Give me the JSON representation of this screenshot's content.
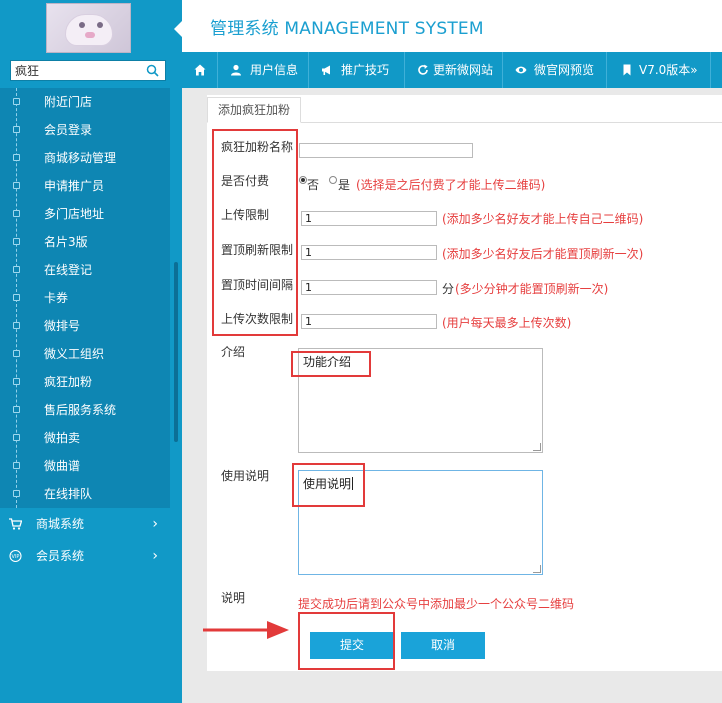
{
  "header": {
    "title": "管理系统 MANAGEMENT SYSTEM"
  },
  "search": {
    "value": "疯狂"
  },
  "sidebar": {
    "sub_items": [
      "附近门店",
      "会员登录",
      "商城移动管理",
      "申请推广员",
      "多门店地址",
      "名片3版",
      "在线登记",
      "卡券",
      "微排号",
      "微义工组织",
      "疯狂加粉",
      "售后服务系统",
      "微拍卖",
      "微曲谱",
      "在线排队"
    ],
    "main_items": [
      {
        "label": "商城系统",
        "icon": "cart-icon"
      },
      {
        "label": "会员系统",
        "icon": "vip-icon"
      }
    ]
  },
  "topnav": {
    "items": [
      {
        "label": "",
        "icon": "home-icon"
      },
      {
        "label": "用户信息",
        "icon": "user-icon"
      },
      {
        "label": "推广技巧",
        "icon": "megaphone-icon"
      },
      {
        "label": "更新微网站",
        "icon": "refresh-icon"
      },
      {
        "label": "微官网预览",
        "icon": "eye-icon"
      },
      {
        "label": "V7.0版本»",
        "icon": "bookmark-icon"
      }
    ]
  },
  "tab": {
    "label": "添加疯狂加粉"
  },
  "form": {
    "name_label": "疯狂加粉名称",
    "name_value": "",
    "pay_label": "是否付费",
    "pay_no": "否",
    "pay_yes": "是",
    "pay_hint": "(选择是之后付费了才能上传二维码)",
    "upload_label": "上传限制",
    "upload_value": "1",
    "upload_hint": "(添加多少名好友才能上传自己二维码)",
    "refresh_label": "置顶刷新限制",
    "refresh_value": "1",
    "refresh_hint": "(添加多少名好友后才能置顶刷新一次)",
    "interval_label": "置顶时间间隔",
    "interval_value": "1",
    "interval_unit": "分",
    "interval_hint": "(多少分钟才能置顶刷新一次)",
    "count_label": "上传次数限制",
    "count_value": "1",
    "count_hint": "(用户每天最多上传次数)",
    "intro_label": "介绍",
    "intro_value": "功能介绍",
    "usage_label": "使用说明",
    "usage_value": "使用说明",
    "note_label": "说明",
    "note_text": "提交成功后请到公众号中添加最少一个公众号二维码",
    "submit_label": "提交",
    "cancel_label": "取消"
  },
  "colors": {
    "accent": "#1199c7",
    "hint": "#e63e3e",
    "highlight": "#e23a3a"
  }
}
